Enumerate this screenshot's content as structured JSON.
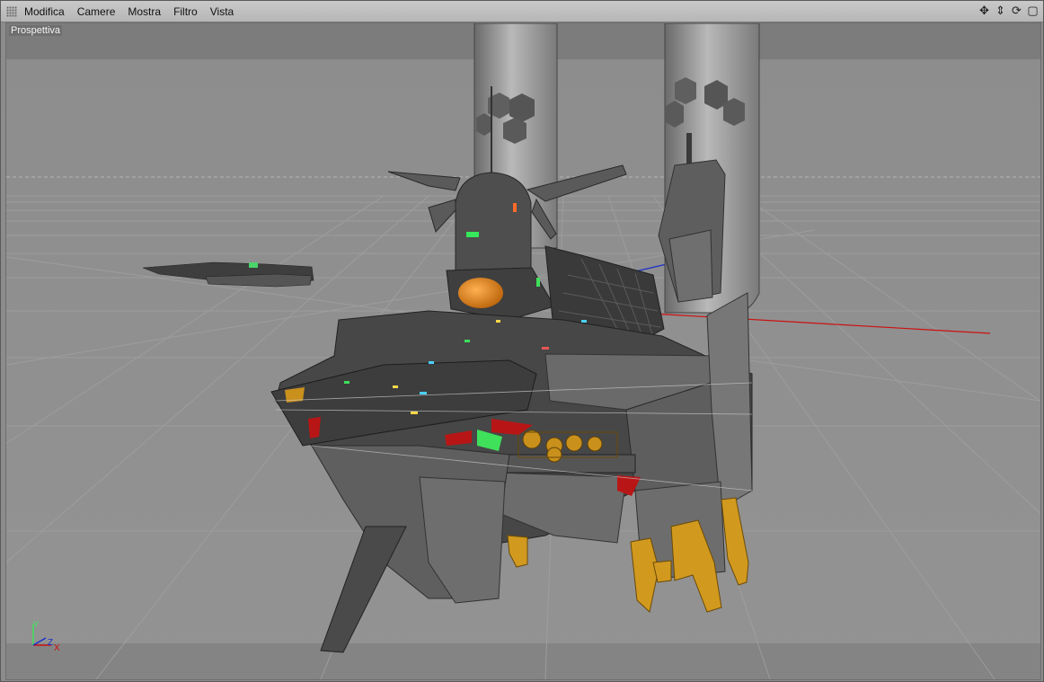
{
  "menubar": {
    "items": [
      "Modifica",
      "Camere",
      "Mostra",
      "Filtro",
      "Vista"
    ]
  },
  "nav_icons": [
    {
      "name": "move-icon",
      "glyph": "✥"
    },
    {
      "name": "dolly-icon",
      "glyph": "⇕"
    },
    {
      "name": "rotate-icon",
      "glyph": "⟳"
    },
    {
      "name": "maximize-icon",
      "glyph": "▢"
    }
  ],
  "viewport": {
    "label": "Prospettiva",
    "axis_labels": {
      "y": "Y",
      "z": "Z",
      "x": "X"
    }
  },
  "colors": {
    "background": "#8e8e8e",
    "grid": "#9c9c9c",
    "hull": "#4a4a4a",
    "hull_light": "#777777",
    "accent_orange": "#e8891a",
    "accent_gold": "#d19a1f",
    "accent_red": "#b81616",
    "accent_green": "#3fe05a",
    "axis_red": "#cc1111",
    "axis_blue": "#1a2fcc"
  }
}
